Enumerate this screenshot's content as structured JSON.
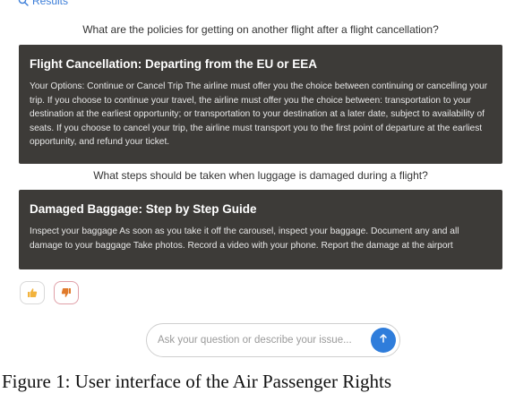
{
  "header": {
    "results_link": "Results",
    "icon": "search-icon"
  },
  "conversation": [
    {
      "question": "What are the policies for getting on another flight after a flight cancellation?",
      "answer_title": "Flight Cancellation: Departing from the EU or EEA",
      "answer_body": "Your Options: Continue or Cancel Trip The airline must offer you the choice between continuing or cancelling your trip. If you choose to continue your travel, the airline must offer you the choice between: transportation to your destination at the earliest opportunity; or transportation to your destination at a later date, subject to availability of seats. If you choose to cancel your trip, the airline must transport you to the first point of departure at the earliest opportunity, and refund your ticket."
    },
    {
      "question": "What steps should be taken when luggage is damaged during a flight?",
      "answer_title": "Damaged Baggage: Step by Step Guide",
      "answer_body": "Inspect your baggage As soon as you take it off the carousel, inspect your baggage. Document any and all damage to your baggage Take photos. Record a video with your phone. Report the damage at the airport"
    }
  ],
  "feedback": {
    "up_icon": "thumbs-up-icon",
    "down_icon": "thumbs-down-icon"
  },
  "composer": {
    "placeholder": "Ask your question or describe your issue...",
    "send_icon": "arrow-up-icon"
  },
  "caption": "Figure 1: User interface of the Air Passenger Rights",
  "colors": {
    "card_bg": "#3d3b38",
    "accent": "#2f7ddb",
    "link": "#3b7dd8",
    "thumbs_up": "#f2b33d",
    "thumbs_down": "#e07a2b"
  }
}
